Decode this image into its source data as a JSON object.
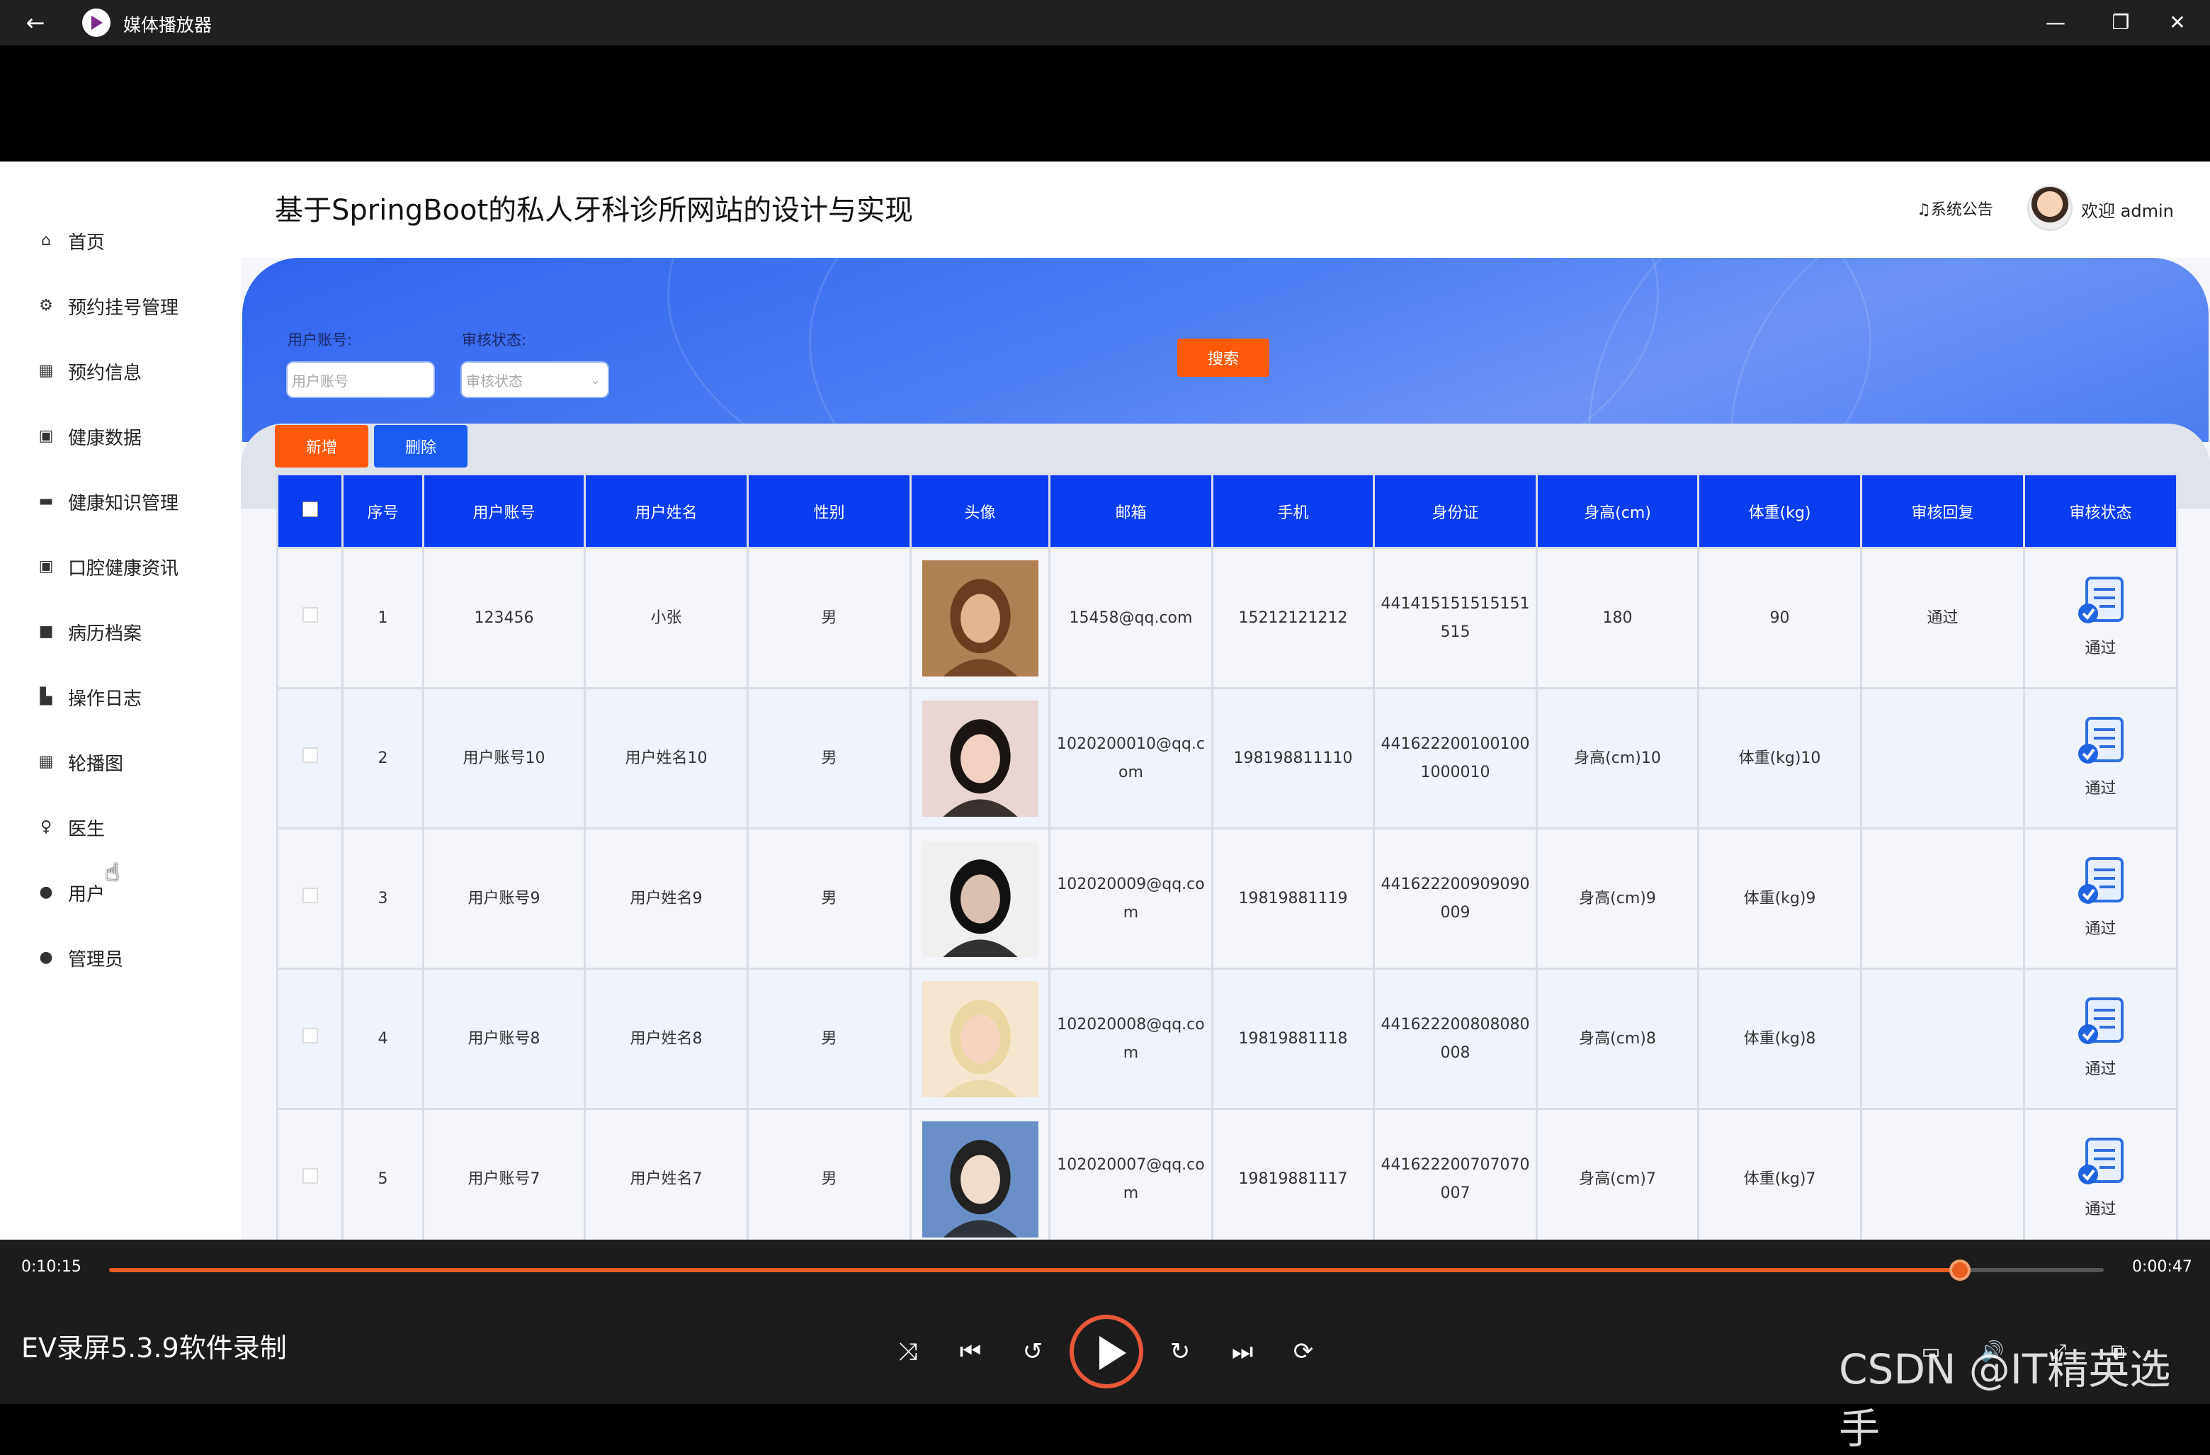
{
  "window": {
    "title": "媒体播放器",
    "back_icon": "←",
    "minimize_icon": "—",
    "maximize_icon": "❐",
    "close_icon": "✕"
  },
  "sidebar": {
    "items": [
      {
        "label": "首页",
        "icon": "home-icon",
        "glyph": "⌂"
      },
      {
        "label": "预约挂号管理",
        "icon": "settings-icon",
        "glyph": "⚙"
      },
      {
        "label": "预约信息",
        "icon": "grid-icon",
        "glyph": "▦"
      },
      {
        "label": "健康数据",
        "icon": "box-icon",
        "glyph": "▣"
      },
      {
        "label": "健康知识管理",
        "icon": "box-icon",
        "glyph": "▬"
      },
      {
        "label": "口腔健康资讯",
        "icon": "briefcase-icon",
        "glyph": "▣"
      },
      {
        "label": "病历档案",
        "icon": "book-icon",
        "glyph": "■"
      },
      {
        "label": "操作日志",
        "icon": "edit-icon",
        "glyph": "▙"
      },
      {
        "label": "轮播图",
        "icon": "grid-icon",
        "glyph": "▦"
      },
      {
        "label": "医生",
        "icon": "user-outline-icon",
        "glyph": "♀"
      },
      {
        "label": "用户",
        "icon": "user-icon",
        "glyph": "●"
      },
      {
        "label": "管理员",
        "icon": "user-icon",
        "glyph": "●"
      }
    ]
  },
  "header": {
    "title": "基于SpringBoot的私人牙科诊所网站的设计与实现",
    "notice": "♫系统公告",
    "welcome": "欢迎 admin"
  },
  "search": {
    "account_label": "用户账号:",
    "account_placeholder": "用户账号",
    "status_label": "审核状态:",
    "status_placeholder": "审核状态",
    "search_button": "搜索"
  },
  "actions": {
    "add": "新增",
    "delete": "删除"
  },
  "table": {
    "columns": [
      "序号",
      "用户账号",
      "用户姓名",
      "性别",
      "头像",
      "邮箱",
      "手机",
      "身份证",
      "身高(cm)",
      "体重(kg)",
      "审核回复",
      "审核状态"
    ],
    "rows": [
      {
        "no": "1",
        "account": "123456",
        "name": "小张",
        "gender": "男",
        "email": "15458@qq.com",
        "phone": "15212121212",
        "id": "441415151515151515",
        "height": "180",
        "weight": "90",
        "reply": "通过",
        "status": "通过"
      },
      {
        "no": "2",
        "account": "用户账号10",
        "name": "用户姓名10",
        "gender": "男",
        "email": "1020200010@qq.com",
        "phone": "198198811110",
        "id": "4416222001001001000010",
        "height": "身高(cm)10",
        "weight": "体重(kg)10",
        "reply": "",
        "status": "通过"
      },
      {
        "no": "3",
        "account": "用户账号9",
        "name": "用户姓名9",
        "gender": "男",
        "email": "102020009@qq.com",
        "phone": "19819881119",
        "id": "441622200909090009",
        "height": "身高(cm)9",
        "weight": "体重(kg)9",
        "reply": "",
        "status": "通过"
      },
      {
        "no": "4",
        "account": "用户账号8",
        "name": "用户姓名8",
        "gender": "男",
        "email": "102020008@qq.com",
        "phone": "19819881118",
        "id": "441622200808080008",
        "height": "身高(cm)8",
        "weight": "体重(kg)8",
        "reply": "",
        "status": "通过"
      },
      {
        "no": "5",
        "account": "用户账号7",
        "name": "用户姓名7",
        "gender": "男",
        "email": "102020007@qq.com",
        "phone": "19819881117",
        "id": "441622200707070007",
        "height": "身高(cm)7",
        "weight": "体重(kg)7",
        "reply": "",
        "status": "通过"
      }
    ]
  },
  "player": {
    "elapsed": "0:10:15",
    "remaining": "0:00:47",
    "progress": 0.928,
    "recorder_label": "EV录屏5.3.9软件录制",
    "watermark": "CSDN @IT精英选手",
    "accent_color": "#e85d20"
  }
}
